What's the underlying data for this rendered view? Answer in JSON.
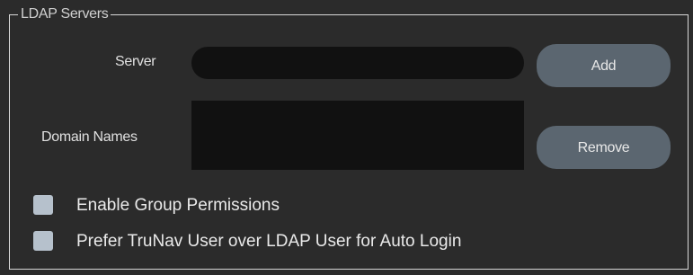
{
  "group": {
    "title": "LDAP Servers"
  },
  "server": {
    "label": "Server",
    "value": "",
    "placeholder": ""
  },
  "domains": {
    "label": "Domain Names",
    "items": []
  },
  "buttons": {
    "add_label": "Add",
    "remove_label": "Remove"
  },
  "options": {
    "group_permissions": {
      "label": "Enable Group Permissions",
      "checked": false
    },
    "prefer_trunav": {
      "label": "Prefer TruNav User over LDAP User for Auto Login",
      "checked": false
    }
  },
  "colors": {
    "background": "#2b2b2b",
    "field": "#111111",
    "button": "#5b6670",
    "checkbox": "#b6c1cc"
  }
}
